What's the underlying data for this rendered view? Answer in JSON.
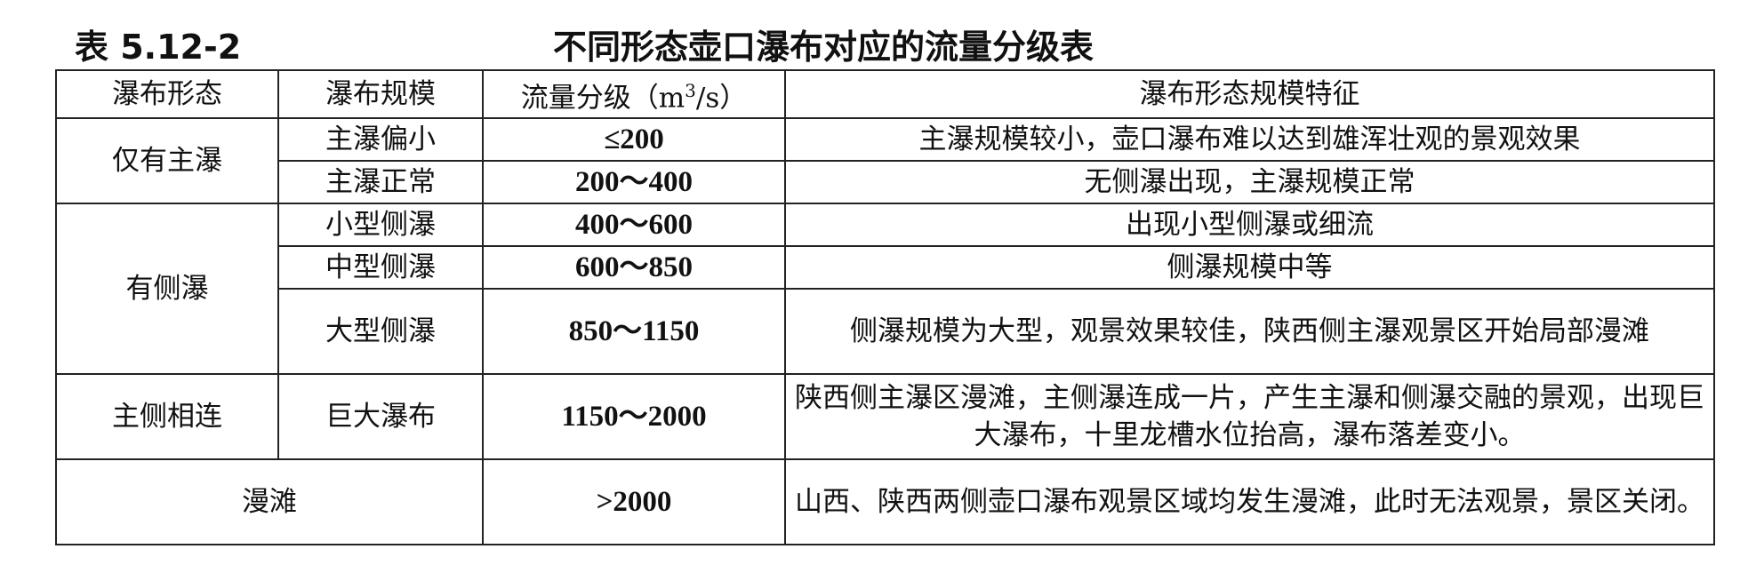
{
  "caption": {
    "number": "表 5.12-2",
    "title": "不同形态壶口瀑布对应的流量分级表"
  },
  "table": {
    "headers": [
      "瀑布形态",
      "瀑布规模",
      "流量分级（m",
      "3",
      "/s）",
      "瀑布形态规模特征"
    ],
    "rows": [
      {
        "form": "仅有主瀑",
        "scale": "主瀑偏小",
        "flow": "≤200",
        "feature": "主瀑规模较小，壶口瀑布难以达到雄浑壮观的景观效果"
      },
      {
        "scale": "主瀑正常",
        "flow": "200～400",
        "feature": "无侧瀑出现，主瀑规模正常"
      },
      {
        "form": "有侧瀑",
        "scale": "小型侧瀑",
        "flow": "400～600",
        "feature": "出现小型侧瀑或细流"
      },
      {
        "scale": "中型侧瀑",
        "flow": "600～850",
        "feature": "侧瀑规模中等"
      },
      {
        "scale": "大型侧瀑",
        "flow": "850～1150",
        "feature": "侧瀑规模为大型，观景效果较佳，陕西侧主瀑观景区开始局部漫滩"
      },
      {
        "form": "主侧相连",
        "scale": "巨大瀑布",
        "flow": "1150～2000",
        "feature": "陕西侧主瀑区漫滩，主侧瀑连成一片，产生主瀑和侧瀑交融的景观，出现巨大瀑布，十里龙槽水位抬高，瀑布落差变小。"
      },
      {
        "form": "漫滩",
        "flow": ">2000",
        "feature": "山西、陕西两侧壶口瀑布观景区域均发生漫滩，此时无法观景，景区关闭。"
      }
    ]
  }
}
